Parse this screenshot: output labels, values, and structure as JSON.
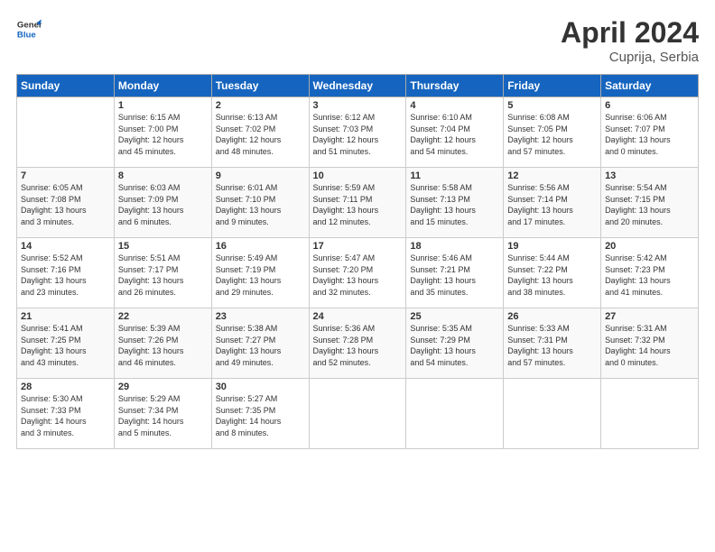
{
  "header": {
    "logo_line1": "General",
    "logo_line2": "Blue",
    "title": "April 2024",
    "subtitle": "Cuprija, Serbia"
  },
  "days_of_week": [
    "Sunday",
    "Monday",
    "Tuesday",
    "Wednesday",
    "Thursday",
    "Friday",
    "Saturday"
  ],
  "weeks": [
    [
      {
        "day": "",
        "info": ""
      },
      {
        "day": "1",
        "info": "Sunrise: 6:15 AM\nSunset: 7:00 PM\nDaylight: 12 hours\nand 45 minutes."
      },
      {
        "day": "2",
        "info": "Sunrise: 6:13 AM\nSunset: 7:02 PM\nDaylight: 12 hours\nand 48 minutes."
      },
      {
        "day": "3",
        "info": "Sunrise: 6:12 AM\nSunset: 7:03 PM\nDaylight: 12 hours\nand 51 minutes."
      },
      {
        "day": "4",
        "info": "Sunrise: 6:10 AM\nSunset: 7:04 PM\nDaylight: 12 hours\nand 54 minutes."
      },
      {
        "day": "5",
        "info": "Sunrise: 6:08 AM\nSunset: 7:05 PM\nDaylight: 12 hours\nand 57 minutes."
      },
      {
        "day": "6",
        "info": "Sunrise: 6:06 AM\nSunset: 7:07 PM\nDaylight: 13 hours\nand 0 minutes."
      }
    ],
    [
      {
        "day": "7",
        "info": "Sunrise: 6:05 AM\nSunset: 7:08 PM\nDaylight: 13 hours\nand 3 minutes."
      },
      {
        "day": "8",
        "info": "Sunrise: 6:03 AM\nSunset: 7:09 PM\nDaylight: 13 hours\nand 6 minutes."
      },
      {
        "day": "9",
        "info": "Sunrise: 6:01 AM\nSunset: 7:10 PM\nDaylight: 13 hours\nand 9 minutes."
      },
      {
        "day": "10",
        "info": "Sunrise: 5:59 AM\nSunset: 7:11 PM\nDaylight: 13 hours\nand 12 minutes."
      },
      {
        "day": "11",
        "info": "Sunrise: 5:58 AM\nSunset: 7:13 PM\nDaylight: 13 hours\nand 15 minutes."
      },
      {
        "day": "12",
        "info": "Sunrise: 5:56 AM\nSunset: 7:14 PM\nDaylight: 13 hours\nand 17 minutes."
      },
      {
        "day": "13",
        "info": "Sunrise: 5:54 AM\nSunset: 7:15 PM\nDaylight: 13 hours\nand 20 minutes."
      }
    ],
    [
      {
        "day": "14",
        "info": "Sunrise: 5:52 AM\nSunset: 7:16 PM\nDaylight: 13 hours\nand 23 minutes."
      },
      {
        "day": "15",
        "info": "Sunrise: 5:51 AM\nSunset: 7:17 PM\nDaylight: 13 hours\nand 26 minutes."
      },
      {
        "day": "16",
        "info": "Sunrise: 5:49 AM\nSunset: 7:19 PM\nDaylight: 13 hours\nand 29 minutes."
      },
      {
        "day": "17",
        "info": "Sunrise: 5:47 AM\nSunset: 7:20 PM\nDaylight: 13 hours\nand 32 minutes."
      },
      {
        "day": "18",
        "info": "Sunrise: 5:46 AM\nSunset: 7:21 PM\nDaylight: 13 hours\nand 35 minutes."
      },
      {
        "day": "19",
        "info": "Sunrise: 5:44 AM\nSunset: 7:22 PM\nDaylight: 13 hours\nand 38 minutes."
      },
      {
        "day": "20",
        "info": "Sunrise: 5:42 AM\nSunset: 7:23 PM\nDaylight: 13 hours\nand 41 minutes."
      }
    ],
    [
      {
        "day": "21",
        "info": "Sunrise: 5:41 AM\nSunset: 7:25 PM\nDaylight: 13 hours\nand 43 minutes."
      },
      {
        "day": "22",
        "info": "Sunrise: 5:39 AM\nSunset: 7:26 PM\nDaylight: 13 hours\nand 46 minutes."
      },
      {
        "day": "23",
        "info": "Sunrise: 5:38 AM\nSunset: 7:27 PM\nDaylight: 13 hours\nand 49 minutes."
      },
      {
        "day": "24",
        "info": "Sunrise: 5:36 AM\nSunset: 7:28 PM\nDaylight: 13 hours\nand 52 minutes."
      },
      {
        "day": "25",
        "info": "Sunrise: 5:35 AM\nSunset: 7:29 PM\nDaylight: 13 hours\nand 54 minutes."
      },
      {
        "day": "26",
        "info": "Sunrise: 5:33 AM\nSunset: 7:31 PM\nDaylight: 13 hours\nand 57 minutes."
      },
      {
        "day": "27",
        "info": "Sunrise: 5:31 AM\nSunset: 7:32 PM\nDaylight: 14 hours\nand 0 minutes."
      }
    ],
    [
      {
        "day": "28",
        "info": "Sunrise: 5:30 AM\nSunset: 7:33 PM\nDaylight: 14 hours\nand 3 minutes."
      },
      {
        "day": "29",
        "info": "Sunrise: 5:29 AM\nSunset: 7:34 PM\nDaylight: 14 hours\nand 5 minutes."
      },
      {
        "day": "30",
        "info": "Sunrise: 5:27 AM\nSunset: 7:35 PM\nDaylight: 14 hours\nand 8 minutes."
      },
      {
        "day": "",
        "info": ""
      },
      {
        "day": "",
        "info": ""
      },
      {
        "day": "",
        "info": ""
      },
      {
        "day": "",
        "info": ""
      }
    ]
  ]
}
